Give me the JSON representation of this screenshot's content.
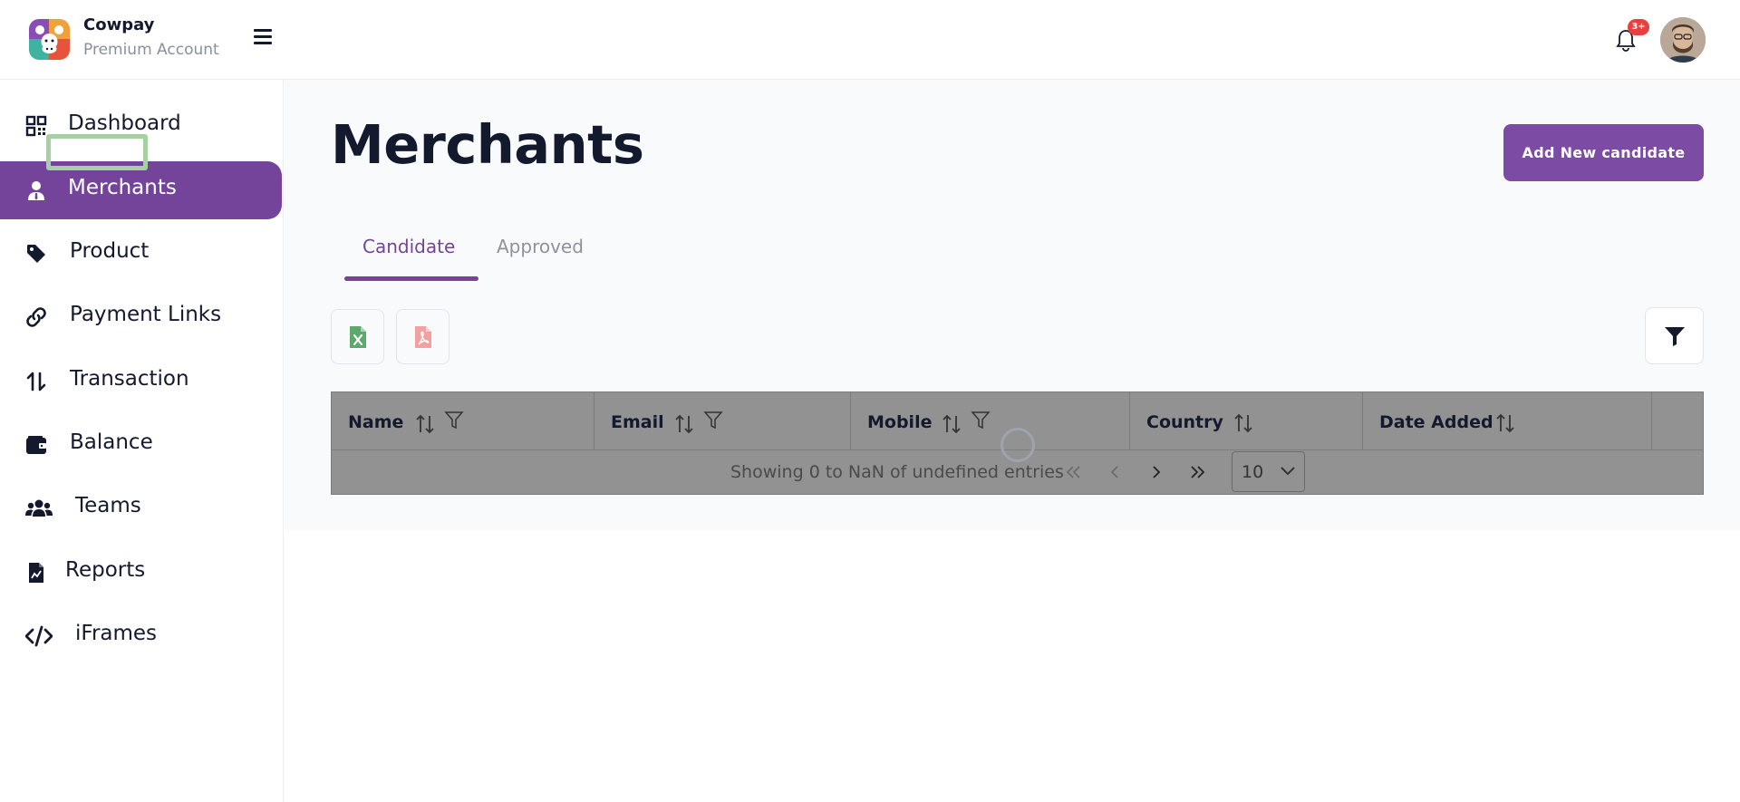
{
  "header": {
    "brand_name": "Cowpay",
    "account_type": "Premium Account",
    "notification_badge": "3+"
  },
  "sidebar": {
    "items": [
      {
        "label": "Dashboard",
        "icon": "qr-grid-icon"
      },
      {
        "label": "Merchants",
        "icon": "user-tie-icon",
        "active": true
      },
      {
        "label": "Product",
        "icon": "tag-icon"
      },
      {
        "label": "Payment Links",
        "icon": "link-icon"
      },
      {
        "label": "Transaction",
        "icon": "arrows-up-down-icon"
      },
      {
        "label": "Balance",
        "icon": "wallet-icon"
      },
      {
        "label": "Teams",
        "icon": "users-icon"
      },
      {
        "label": "Reports",
        "icon": "file-chart-icon"
      },
      {
        "label": "iFrames",
        "icon": "code-icon"
      }
    ]
  },
  "main": {
    "title": "Merchants",
    "add_button": "Add New candidate",
    "tabs": [
      {
        "label": "Candidate",
        "active": true
      },
      {
        "label": "Approved",
        "active": false
      }
    ],
    "table": {
      "columns": [
        {
          "label": "Name",
          "sortable": true,
          "filterable": true
        },
        {
          "label": "Email",
          "sortable": true,
          "filterable": true
        },
        {
          "label": "Mobile",
          "sortable": true,
          "filterable": true
        },
        {
          "label": "Country",
          "sortable": true,
          "filterable": false
        },
        {
          "label": "Date Added",
          "sortable": true,
          "filterable": false
        }
      ],
      "rows": [],
      "pagination_info": "Showing 0 to NaN of undefined entries",
      "rows_per_page": "10"
    }
  },
  "colors": {
    "accent": "#74449a",
    "button": "#7c4ca4",
    "badge": "#e8403d",
    "excel": "#5fa86c",
    "pdf": "#f2a0a0"
  }
}
